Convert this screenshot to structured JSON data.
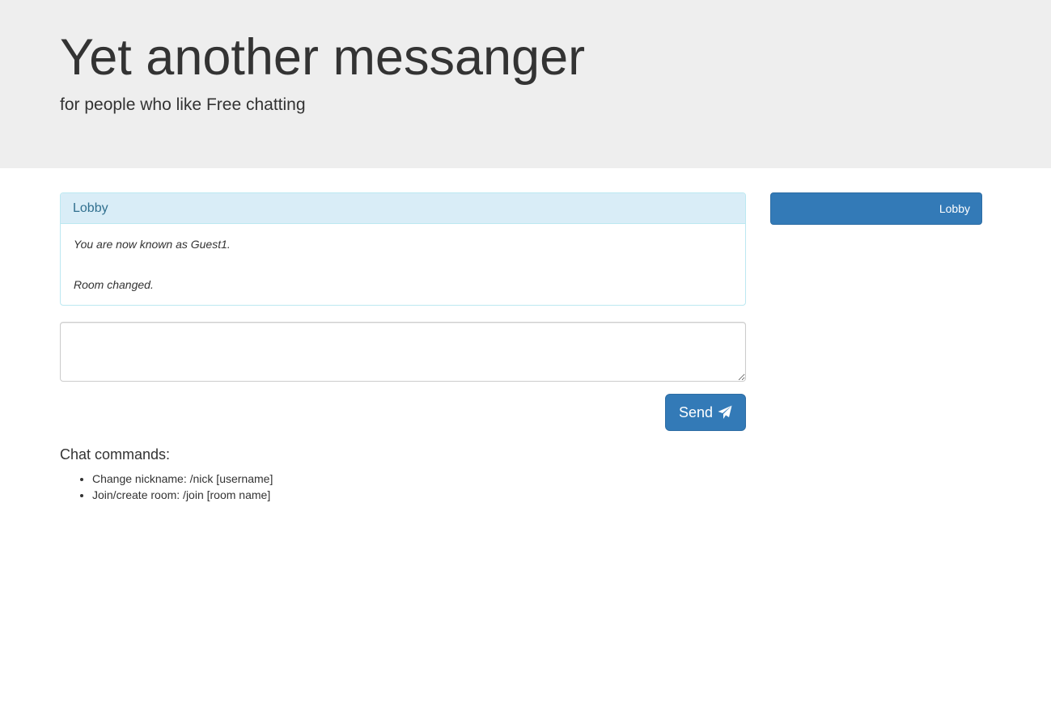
{
  "header": {
    "title": "Yet another messanger",
    "subtitle": "for people who like Free chatting"
  },
  "room_panel": {
    "heading": "Lobby",
    "messages": [
      "You are now known as Guest1.",
      "Room changed."
    ]
  },
  "composer": {
    "value": "",
    "send_label": "Send",
    "send_icon": "paper-plane-icon"
  },
  "commands": {
    "title": "Chat commands:",
    "items": [
      "Change nickname: /nick [username]",
      "Join/create room: /join [room name]"
    ]
  },
  "rooms": [
    {
      "label": "Lobby"
    }
  ],
  "colors": {
    "primary": "#337ab7",
    "panel_heading_bg": "#d9edf7",
    "panel_border": "#bce8f1",
    "jumbotron_bg": "#eeeeee"
  }
}
